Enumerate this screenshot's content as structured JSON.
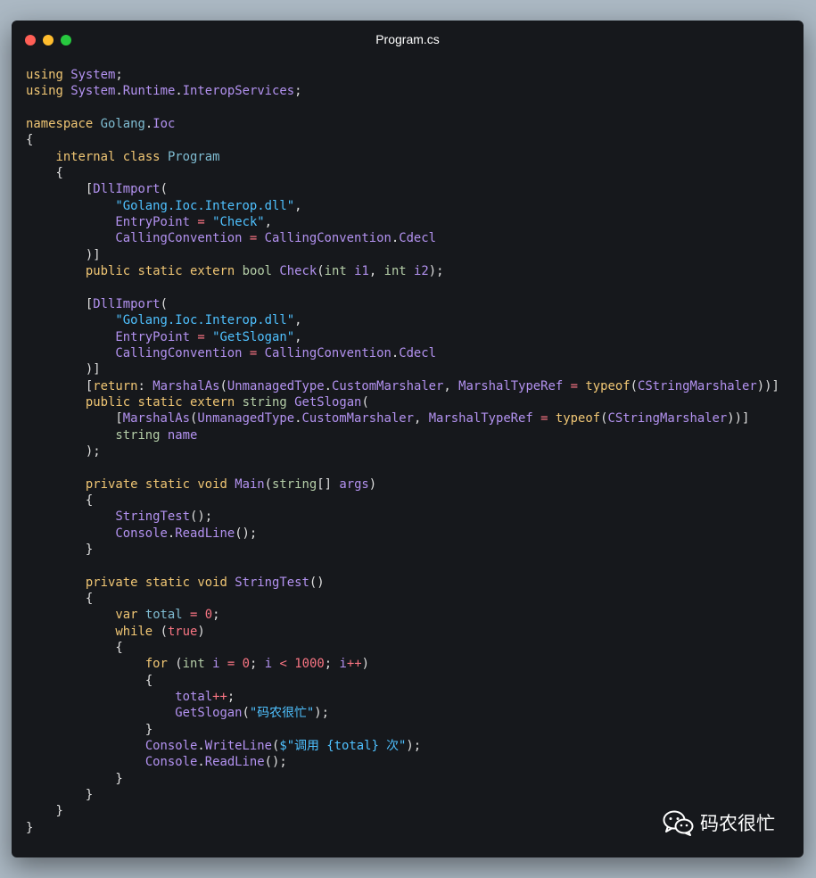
{
  "window": {
    "title": "Program.cs",
    "controls": [
      "close",
      "minimize",
      "maximize"
    ]
  },
  "watermark": {
    "icon": "wechat-icon",
    "text": "码农很忙"
  },
  "code_lines": [
    [
      [
        "kw",
        "using"
      ],
      [
        "plain",
        " "
      ],
      [
        "pur",
        "System"
      ],
      [
        "punc",
        ";"
      ]
    ],
    [
      [
        "kw",
        "using"
      ],
      [
        "plain",
        " "
      ],
      [
        "pur",
        "System"
      ],
      [
        "punc",
        "."
      ],
      [
        "pur",
        "Runtime"
      ],
      [
        "punc",
        "."
      ],
      [
        "pur",
        "InteropServices"
      ],
      [
        "punc",
        ";"
      ]
    ],
    [],
    [
      [
        "kw",
        "namespace"
      ],
      [
        "plain",
        " "
      ],
      [
        "ty",
        "Golang"
      ],
      [
        "punc",
        "."
      ],
      [
        "pur",
        "Ioc"
      ]
    ],
    [
      [
        "punc",
        "{"
      ]
    ],
    [
      [
        "plain",
        "    "
      ],
      [
        "kw",
        "internal"
      ],
      [
        "plain",
        " "
      ],
      [
        "kw",
        "class"
      ],
      [
        "plain",
        " "
      ],
      [
        "ty",
        "Program"
      ]
    ],
    [
      [
        "plain",
        "    "
      ],
      [
        "punc",
        "{"
      ]
    ],
    [
      [
        "plain",
        "        "
      ],
      [
        "punc",
        "["
      ],
      [
        "pur",
        "DllImport"
      ],
      [
        "punc",
        "("
      ]
    ],
    [
      [
        "plain",
        "            "
      ],
      [
        "str",
        "\"Golang.Ioc.Interop.dll\""
      ],
      [
        "punc",
        ","
      ]
    ],
    [
      [
        "plain",
        "            "
      ],
      [
        "pur",
        "EntryPoint"
      ],
      [
        "plain",
        " "
      ],
      [
        "op",
        "="
      ],
      [
        "plain",
        " "
      ],
      [
        "str",
        "\"Check\""
      ],
      [
        "punc",
        ","
      ]
    ],
    [
      [
        "plain",
        "            "
      ],
      [
        "pur",
        "CallingConvention"
      ],
      [
        "plain",
        " "
      ],
      [
        "op",
        "="
      ],
      [
        "plain",
        " "
      ],
      [
        "pur",
        "CallingConvention"
      ],
      [
        "punc",
        "."
      ],
      [
        "pur",
        "Cdecl"
      ]
    ],
    [
      [
        "plain",
        "        "
      ],
      [
        "punc",
        ")]"
      ]
    ],
    [
      [
        "plain",
        "        "
      ],
      [
        "kw",
        "public"
      ],
      [
        "plain",
        " "
      ],
      [
        "kw",
        "static"
      ],
      [
        "plain",
        " "
      ],
      [
        "kw",
        "extern"
      ],
      [
        "plain",
        " "
      ],
      [
        "kw2",
        "bool"
      ],
      [
        "plain",
        " "
      ],
      [
        "pur",
        "Check"
      ],
      [
        "punc",
        "("
      ],
      [
        "kw2",
        "int"
      ],
      [
        "plain",
        " "
      ],
      [
        "pur",
        "i1"
      ],
      [
        "punc",
        ","
      ],
      [
        "plain",
        " "
      ],
      [
        "kw2",
        "int"
      ],
      [
        "plain",
        " "
      ],
      [
        "pur",
        "i2"
      ],
      [
        "punc",
        ");"
      ]
    ],
    [],
    [
      [
        "plain",
        "        "
      ],
      [
        "punc",
        "["
      ],
      [
        "pur",
        "DllImport"
      ],
      [
        "punc",
        "("
      ]
    ],
    [
      [
        "plain",
        "            "
      ],
      [
        "str",
        "\"Golang.Ioc.Interop.dll\""
      ],
      [
        "punc",
        ","
      ]
    ],
    [
      [
        "plain",
        "            "
      ],
      [
        "pur",
        "EntryPoint"
      ],
      [
        "plain",
        " "
      ],
      [
        "op",
        "="
      ],
      [
        "plain",
        " "
      ],
      [
        "str",
        "\"GetSlogan\""
      ],
      [
        "punc",
        ","
      ]
    ],
    [
      [
        "plain",
        "            "
      ],
      [
        "pur",
        "CallingConvention"
      ],
      [
        "plain",
        " "
      ],
      [
        "op",
        "="
      ],
      [
        "plain",
        " "
      ],
      [
        "pur",
        "CallingConvention"
      ],
      [
        "punc",
        "."
      ],
      [
        "pur",
        "Cdecl"
      ]
    ],
    [
      [
        "plain",
        "        "
      ],
      [
        "punc",
        ")]"
      ]
    ],
    [
      [
        "plain",
        "        "
      ],
      [
        "punc",
        "["
      ],
      [
        "kw",
        "return"
      ],
      [
        "punc",
        ":"
      ],
      [
        "plain",
        " "
      ],
      [
        "pur",
        "MarshalAs"
      ],
      [
        "punc",
        "("
      ],
      [
        "pur",
        "UnmanagedType"
      ],
      [
        "punc",
        "."
      ],
      [
        "pur",
        "CustomMarshaler"
      ],
      [
        "punc",
        ","
      ],
      [
        "plain",
        " "
      ],
      [
        "pur",
        "MarshalTypeRef"
      ],
      [
        "plain",
        " "
      ],
      [
        "op",
        "="
      ],
      [
        "plain",
        " "
      ],
      [
        "kw",
        "typeof"
      ],
      [
        "punc",
        "("
      ],
      [
        "pur",
        "CStringMarshaler"
      ],
      [
        "punc",
        "))]"
      ]
    ],
    [
      [
        "plain",
        "        "
      ],
      [
        "kw",
        "public"
      ],
      [
        "plain",
        " "
      ],
      [
        "kw",
        "static"
      ],
      [
        "plain",
        " "
      ],
      [
        "kw",
        "extern"
      ],
      [
        "plain",
        " "
      ],
      [
        "kw2",
        "string"
      ],
      [
        "plain",
        " "
      ],
      [
        "pur",
        "GetSlogan"
      ],
      [
        "punc",
        "("
      ]
    ],
    [
      [
        "plain",
        "            "
      ],
      [
        "punc",
        "["
      ],
      [
        "pur",
        "MarshalAs"
      ],
      [
        "punc",
        "("
      ],
      [
        "pur",
        "UnmanagedType"
      ],
      [
        "punc",
        "."
      ],
      [
        "pur",
        "CustomMarshaler"
      ],
      [
        "punc",
        ","
      ],
      [
        "plain",
        " "
      ],
      [
        "pur",
        "MarshalTypeRef"
      ],
      [
        "plain",
        " "
      ],
      [
        "op",
        "="
      ],
      [
        "plain",
        " "
      ],
      [
        "kw",
        "typeof"
      ],
      [
        "punc",
        "("
      ],
      [
        "pur",
        "CStringMarshaler"
      ],
      [
        "punc",
        "))]"
      ]
    ],
    [
      [
        "plain",
        "            "
      ],
      [
        "kw2",
        "string"
      ],
      [
        "plain",
        " "
      ],
      [
        "pur",
        "name"
      ]
    ],
    [
      [
        "plain",
        "        "
      ],
      [
        "punc",
        ");"
      ]
    ],
    [],
    [
      [
        "plain",
        "        "
      ],
      [
        "kw",
        "private"
      ],
      [
        "plain",
        " "
      ],
      [
        "kw",
        "static"
      ],
      [
        "plain",
        " "
      ],
      [
        "kw",
        "void"
      ],
      [
        "plain",
        " "
      ],
      [
        "pur",
        "Main"
      ],
      [
        "punc",
        "("
      ],
      [
        "kw2",
        "string"
      ],
      [
        "punc",
        "[]"
      ],
      [
        "plain",
        " "
      ],
      [
        "pur",
        "args"
      ],
      [
        "punc",
        ")"
      ]
    ],
    [
      [
        "plain",
        "        "
      ],
      [
        "punc",
        "{"
      ]
    ],
    [
      [
        "plain",
        "            "
      ],
      [
        "pur",
        "StringTest"
      ],
      [
        "punc",
        "();"
      ]
    ],
    [
      [
        "plain",
        "            "
      ],
      [
        "pur",
        "Console"
      ],
      [
        "punc",
        "."
      ],
      [
        "pur",
        "ReadLine"
      ],
      [
        "punc",
        "();"
      ]
    ],
    [
      [
        "plain",
        "        "
      ],
      [
        "punc",
        "}"
      ]
    ],
    [],
    [
      [
        "plain",
        "        "
      ],
      [
        "kw",
        "private"
      ],
      [
        "plain",
        " "
      ],
      [
        "kw",
        "static"
      ],
      [
        "plain",
        " "
      ],
      [
        "kw",
        "void"
      ],
      [
        "plain",
        " "
      ],
      [
        "pur",
        "StringTest"
      ],
      [
        "punc",
        "()"
      ]
    ],
    [
      [
        "plain",
        "        "
      ],
      [
        "punc",
        "{"
      ]
    ],
    [
      [
        "plain",
        "            "
      ],
      [
        "kw",
        "var"
      ],
      [
        "plain",
        " "
      ],
      [
        "ty",
        "total"
      ],
      [
        "plain",
        " "
      ],
      [
        "op",
        "="
      ],
      [
        "plain",
        " "
      ],
      [
        "num",
        "0"
      ],
      [
        "punc",
        ";"
      ]
    ],
    [
      [
        "plain",
        "            "
      ],
      [
        "kw",
        "while"
      ],
      [
        "plain",
        " "
      ],
      [
        "punc",
        "("
      ],
      [
        "num",
        "true"
      ],
      [
        "punc",
        ")"
      ]
    ],
    [
      [
        "plain",
        "            "
      ],
      [
        "punc",
        "{"
      ]
    ],
    [
      [
        "plain",
        "                "
      ],
      [
        "kw",
        "for"
      ],
      [
        "plain",
        " "
      ],
      [
        "punc",
        "("
      ],
      [
        "kw2",
        "int"
      ],
      [
        "plain",
        " "
      ],
      [
        "pur",
        "i"
      ],
      [
        "plain",
        " "
      ],
      [
        "op",
        "="
      ],
      [
        "plain",
        " "
      ],
      [
        "num",
        "0"
      ],
      [
        "punc",
        ";"
      ],
      [
        "plain",
        " "
      ],
      [
        "pur",
        "i"
      ],
      [
        "plain",
        " "
      ],
      [
        "op",
        "<"
      ],
      [
        "plain",
        " "
      ],
      [
        "num",
        "1000"
      ],
      [
        "punc",
        ";"
      ],
      [
        "plain",
        " "
      ],
      [
        "pur",
        "i"
      ],
      [
        "op",
        "++"
      ],
      [
        "punc",
        ")"
      ]
    ],
    [
      [
        "plain",
        "                "
      ],
      [
        "punc",
        "{"
      ]
    ],
    [
      [
        "plain",
        "                    "
      ],
      [
        "pur",
        "total"
      ],
      [
        "op",
        "++"
      ],
      [
        "punc",
        ";"
      ]
    ],
    [
      [
        "plain",
        "                    "
      ],
      [
        "pur",
        "GetSlogan"
      ],
      [
        "punc",
        "("
      ],
      [
        "str",
        "\"码农很忙\""
      ],
      [
        "punc",
        ");"
      ]
    ],
    [
      [
        "plain",
        "                "
      ],
      [
        "punc",
        "}"
      ]
    ],
    [
      [
        "plain",
        "                "
      ],
      [
        "pur",
        "Console"
      ],
      [
        "punc",
        "."
      ],
      [
        "pur",
        "WriteLine"
      ],
      [
        "punc",
        "("
      ],
      [
        "str",
        "$\"调用 {total} 次\""
      ],
      [
        "punc",
        ");"
      ]
    ],
    [
      [
        "plain",
        "                "
      ],
      [
        "pur",
        "Console"
      ],
      [
        "punc",
        "."
      ],
      [
        "pur",
        "ReadLine"
      ],
      [
        "punc",
        "();"
      ]
    ],
    [
      [
        "plain",
        "            "
      ],
      [
        "punc",
        "}"
      ]
    ],
    [
      [
        "plain",
        "        "
      ],
      [
        "punc",
        "}"
      ]
    ],
    [
      [
        "plain",
        "    "
      ],
      [
        "punc",
        "}"
      ]
    ],
    [
      [
        "punc",
        "}"
      ]
    ]
  ]
}
